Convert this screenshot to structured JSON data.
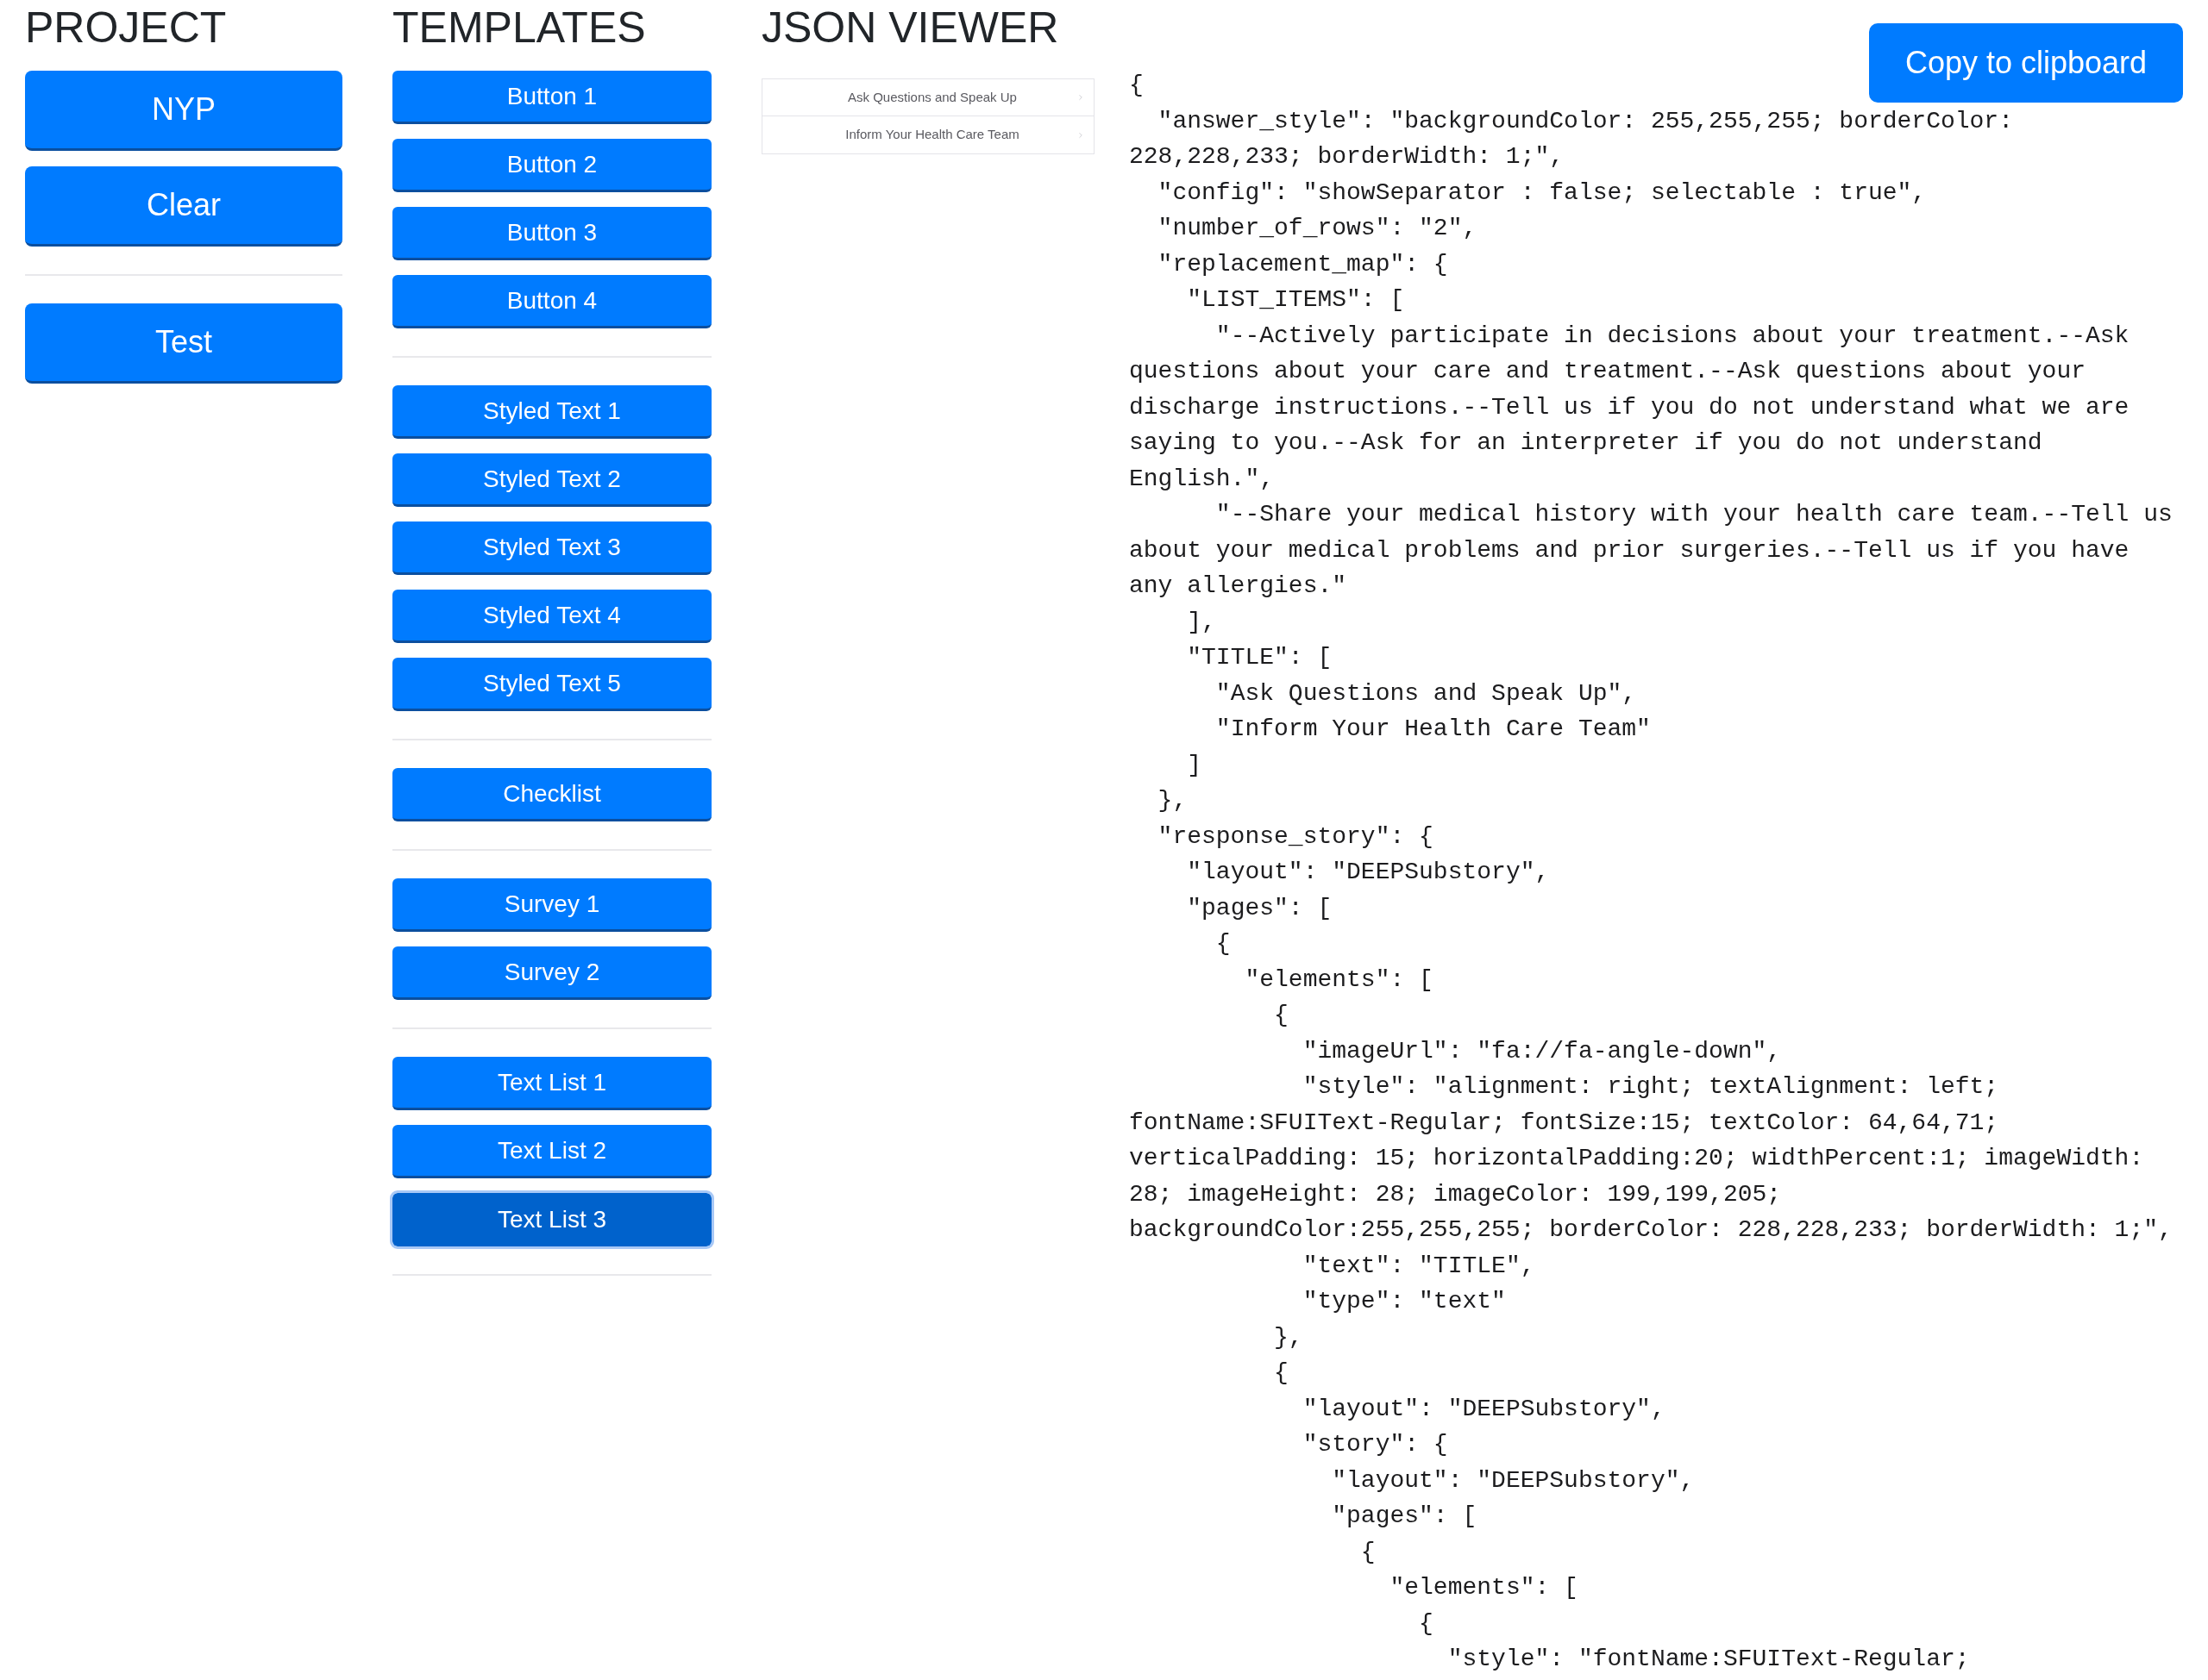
{
  "project": {
    "heading": "PROJECT",
    "groups": [
      {
        "buttons": [
          {
            "label": "NYP"
          },
          {
            "label": "Clear"
          }
        ]
      },
      {
        "buttons": [
          {
            "label": "Test"
          }
        ]
      }
    ]
  },
  "templates": {
    "heading": "TEMPLATES",
    "groups": [
      {
        "buttons": [
          {
            "label": "Button 1",
            "selected": false
          },
          {
            "label": "Button 2",
            "selected": false
          },
          {
            "label": "Button 3",
            "selected": false
          },
          {
            "label": "Button 4",
            "selected": false
          }
        ]
      },
      {
        "buttons": [
          {
            "label": "Styled Text 1",
            "selected": false
          },
          {
            "label": "Styled Text 2",
            "selected": false
          },
          {
            "label": "Styled Text 3",
            "selected": false
          },
          {
            "label": "Styled Text 4",
            "selected": false
          },
          {
            "label": "Styled Text 5",
            "selected": false
          }
        ]
      },
      {
        "buttons": [
          {
            "label": "Checklist",
            "selected": false
          }
        ]
      },
      {
        "buttons": [
          {
            "label": "Survey 1",
            "selected": false
          },
          {
            "label": "Survey 2",
            "selected": false
          }
        ]
      },
      {
        "buttons": [
          {
            "label": "Text List 1",
            "selected": false
          },
          {
            "label": "Text List 2",
            "selected": false
          },
          {
            "label": "Text List 3",
            "selected": true
          }
        ]
      }
    ]
  },
  "json_viewer": {
    "heading": "JSON VIEWER",
    "preview_rows": [
      {
        "title": "Ask Questions and Speak Up"
      },
      {
        "title": "Inform Your Health Care Team"
      }
    ],
    "copy_button": "Copy to clipboard",
    "json_lines": [
      "{",
      "  \"answer_style\": \"backgroundColor: 255,255,255; borderColor: 228,228,233; borderWidth: 1;\",",
      "  \"config\": \"showSeparator : false; selectable : true\",",
      "  \"number_of_rows\": \"2\",",
      "  \"replacement_map\": {",
      "    \"LIST_ITEMS\": [",
      "      \"--Actively participate in decisions about your treatment.--Ask questions about your care and treatment.--Ask questions about your discharge instructions.--Tell us if you do not understand what we are saying to you.--Ask for an interpreter if you do not understand English.\",",
      "      \"--Share your medical history with your health care team.--Tell us about your medical problems and prior surgeries.--Tell us if you have any allergies.\"",
      "    ],",
      "    \"TITLE\": [",
      "      \"Ask Questions and Speak Up\",",
      "      \"Inform Your Health Care Team\"",
      "    ]",
      "  },",
      "  \"response_story\": {",
      "    \"layout\": \"DEEPSubstory\",",
      "    \"pages\": [",
      "      {",
      "        \"elements\": [",
      "          {",
      "            \"imageUrl\": \"fa://fa-angle-down\",",
      "            \"style\": \"alignment: right; textAlignment: left; fontName:SFUIText-Regular; fontSize:15; textColor: 64,64,71; verticalPadding: 15; horizontalPadding:20; widthPercent:1; imageWidth: 28; imageHeight: 28; imageColor: 199,199,205; backgroundColor:255,255,255; borderColor: 228,228,233; borderWidth: 1;\",",
      "            \"text\": \"TITLE\",",
      "            \"type\": \"text\"",
      "          },",
      "          {",
      "            \"layout\": \"DEEPSubstory\",",
      "            \"story\": {",
      "              \"layout\": \"DEEPSubstory\",",
      "              \"pages\": [",
      "                {",
      "                  \"elements\": [",
      "                    {",
      "                      \"style\": \"fontName:SFUIText-Regular;"
    ]
  }
}
